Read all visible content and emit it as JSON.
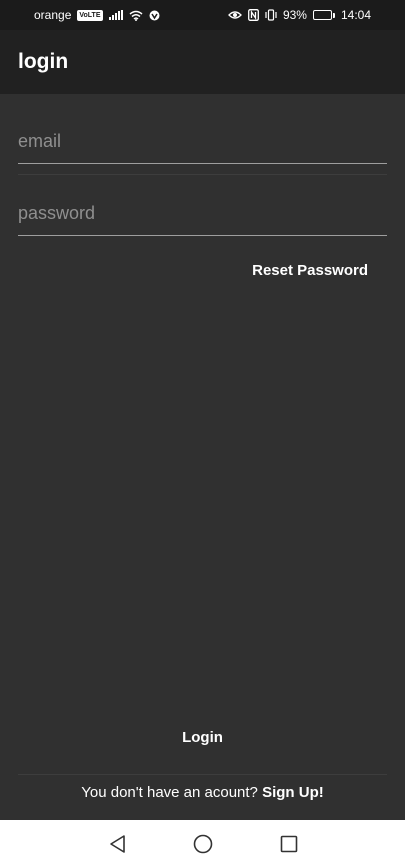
{
  "status_bar": {
    "carrier": "orange",
    "volte": "VoLTE",
    "battery_percent": "93%",
    "battery_level": 0.93,
    "time": "14:04",
    "icons": [
      "signal-icon",
      "wifi-icon",
      "vpn-icon",
      "eye-icon",
      "nfc-icon",
      "vibrate-icon",
      "battery-icon"
    ]
  },
  "app_bar": {
    "title": "login"
  },
  "form": {
    "email_placeholder": "email",
    "password_placeholder": "password",
    "reset_label": "Reset Password",
    "login_label": "Login"
  },
  "signup": {
    "prompt": "You don't have an acount?",
    "link": "Sign Up!"
  },
  "nav_bar": {
    "icons": [
      "back-icon",
      "home-icon",
      "recents-icon"
    ]
  },
  "colors": {
    "background": "#303030",
    "app_bar": "#212121",
    "status_bar": "#1b1b1b",
    "nav_bar": "#ffffff"
  }
}
